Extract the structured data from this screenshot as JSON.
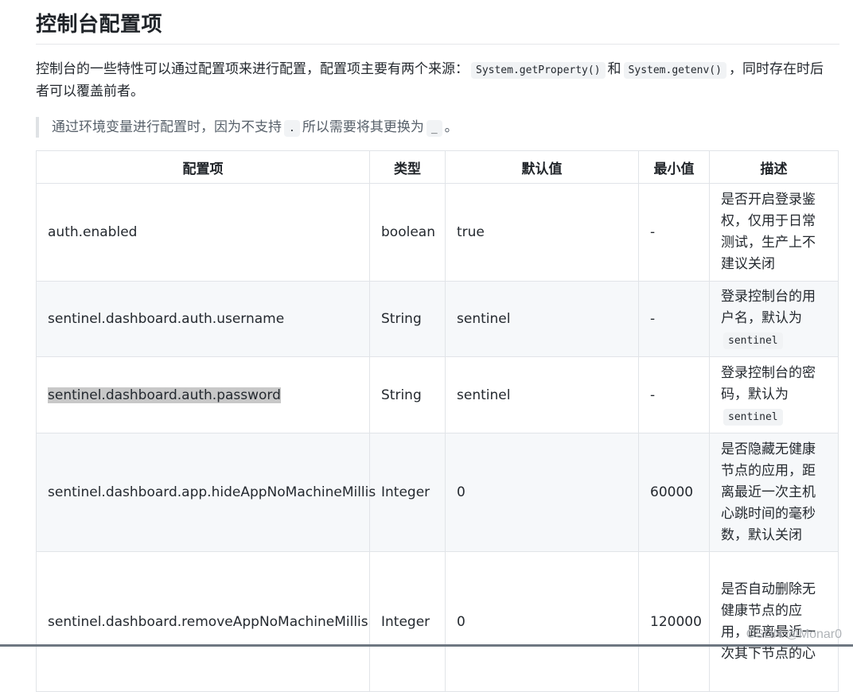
{
  "heading": "控制台配置项",
  "intro": {
    "text_a": "控制台的一些特性可以通过配置项来进行配置，配置项主要有两个来源：",
    "code_a": "System.getProperty()",
    "text_b": "和",
    "code_b": "System.getenv()",
    "text_c": "，同时存在时后者可以覆盖前者。"
  },
  "note": {
    "text_a": "通过环境变量进行配置时，因为不支持",
    "code_a": ".",
    "text_b": "所以需要将其更换为",
    "code_b": "_",
    "text_c": "。"
  },
  "table": {
    "headers": [
      "配置项",
      "类型",
      "默认值",
      "最小值",
      "描述"
    ],
    "rows": [
      {
        "key": "auth.enabled",
        "type": "boolean",
        "default": "true",
        "min": "-",
        "desc": "是否开启登录鉴权，仅用于日常测试，生产上不建议关闭",
        "desc_code": ""
      },
      {
        "key": "sentinel.dashboard.auth.username",
        "type": "String",
        "default": "sentinel",
        "min": "-",
        "desc": "登录控制台的用户名，默认为",
        "desc_code": "sentinel"
      },
      {
        "key": "sentinel.dashboard.auth.password",
        "type": "String",
        "default": "sentinel",
        "min": "-",
        "desc": "登录控制台的密码，默认为",
        "desc_code": "sentinel"
      },
      {
        "key": "sentinel.dashboard.app.hideAppNoMachineMillis",
        "type": "Integer",
        "default": "0",
        "min": "60000",
        "desc": "是否隐藏无健康节点的应用，距离最近一次主机心跳时间的毫秒数，默认关闭",
        "desc_code": ""
      },
      {
        "key": "sentinel.dashboard.removeAppNoMachineMillis",
        "type": "Integer",
        "default": "0",
        "min": "120000",
        "desc": "是否自动删除无健康节点的应用，距离最近一次其下节点的心",
        "desc_code": ""
      }
    ]
  },
  "watermark": "CSDN @Monar0"
}
